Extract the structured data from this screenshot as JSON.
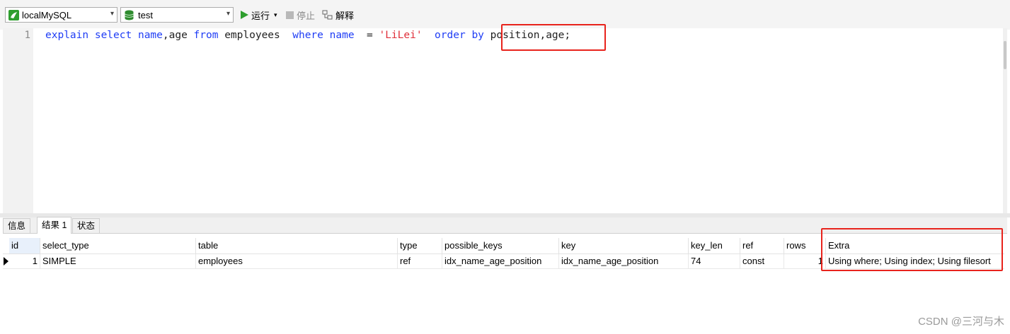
{
  "toolbar": {
    "connection": "localMySQL",
    "database": "test",
    "run_label": "运行",
    "stop_label": "停止",
    "explain_label": "解释",
    "colors": {
      "run_green": "#2e9e2e",
      "db_green": "#2e8b2e"
    }
  },
  "editor": {
    "line_number": "1",
    "tokens": [
      {
        "text": "explain",
        "type": "keyword"
      },
      {
        "text": " ",
        "type": "plain"
      },
      {
        "text": "select",
        "type": "keyword"
      },
      {
        "text": " ",
        "type": "plain"
      },
      {
        "text": "name",
        "type": "keyword"
      },
      {
        "text": ",age ",
        "type": "plain"
      },
      {
        "text": "from",
        "type": "keyword"
      },
      {
        "text": " employees  ",
        "type": "plain"
      },
      {
        "text": "where",
        "type": "keyword"
      },
      {
        "text": " ",
        "type": "plain"
      },
      {
        "text": "name",
        "type": "keyword"
      },
      {
        "text": "  = ",
        "type": "plain"
      },
      {
        "text": "'LiLei'",
        "type": "string"
      },
      {
        "text": "  ",
        "type": "plain"
      },
      {
        "text": "order",
        "type": "keyword"
      },
      {
        "text": " ",
        "type": "plain"
      },
      {
        "text": "by",
        "type": "keyword"
      },
      {
        "text": " position,age;",
        "type": "plain"
      }
    ]
  },
  "result_tabs": [
    "信息",
    "结果 1",
    "状态"
  ],
  "active_tab": "结果 1",
  "table": {
    "columns": [
      "id",
      "select_type",
      "table",
      "type",
      "possible_keys",
      "key",
      "key_len",
      "ref",
      "rows",
      "Extra"
    ],
    "rows": [
      [
        "1",
        "SIMPLE",
        "employees",
        "ref",
        "idx_name_age_position",
        "idx_name_age_position",
        "74",
        "const",
        "1",
        "Using where; Using index; Using filesort"
      ]
    ]
  },
  "annotation_color": "#e8231c",
  "watermark": "CSDN @三河与木"
}
